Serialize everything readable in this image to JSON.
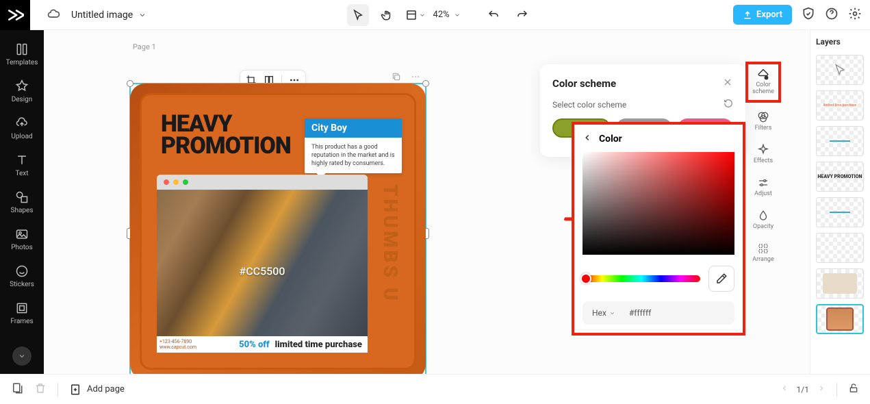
{
  "header": {
    "doc_title": "Untitled image",
    "zoom": "42%",
    "export_label": "Export"
  },
  "leftnav": {
    "templates": "Templates",
    "design": "Design",
    "upload": "Upload",
    "text": "Text",
    "shapes": "Shapes",
    "photos": "Photos",
    "stickers": "Stickers",
    "frames": "Frames"
  },
  "canvas": {
    "page_label": "Page 1",
    "heavy_line1": "HEAVY",
    "heavy_line2": "PROMOTION",
    "city_title": "City Boy",
    "city_body": "This product has a good reputation in the market and is highly rated by consumers.",
    "hex_overlay": "#CC5500",
    "thumbs": "THUMBS U",
    "footer_phone": "+123-456-7890",
    "footer_site": "www.capcut.com",
    "discount": "50% off",
    "cta": "limited time purchase"
  },
  "panel": {
    "title": "Color scheme",
    "subtitle": "Select color scheme",
    "color_title": "Color",
    "hex_label": "Hex",
    "hex_value": "#ffffff",
    "swatches": [
      "#8aa02a",
      "#999999",
      "#e85a8a"
    ]
  },
  "rightcol": {
    "color_scheme": "Color scheme",
    "filters": "Filters",
    "effects": "Effects",
    "adjust": "Adjust",
    "opacity": "Opacity",
    "arrange": "Arrange"
  },
  "layers": {
    "title": "Layers",
    "thumb_text": "HEAVY PROMOTION"
  },
  "footer": {
    "add_page": "Add page",
    "page_count": "1/1"
  }
}
